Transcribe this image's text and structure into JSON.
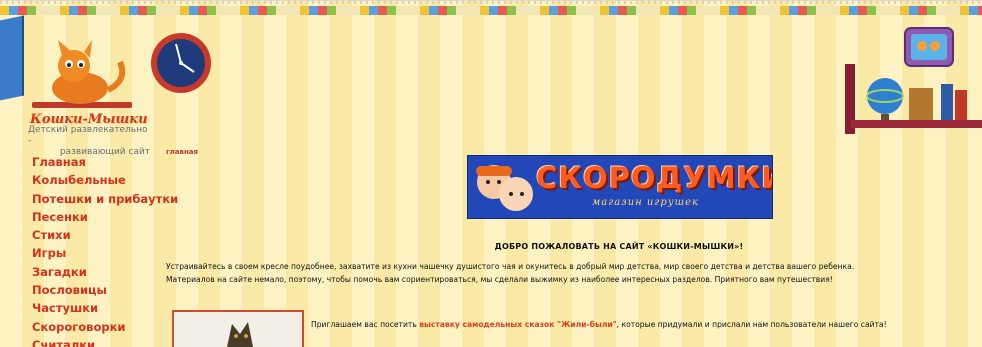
{
  "logo": {
    "title": "Кошки-Мышки",
    "subtitle_line1": "Детский развлекательно -",
    "subtitle_line2": "развивающий сайт"
  },
  "breadcrumb": "главная",
  "nav": {
    "items": [
      "Главная",
      "Колыбельные",
      "Потешки и прибаутки",
      "Песенки",
      "Стихи",
      "Игры",
      "Загадки",
      "Пословицы",
      "Частушки",
      "Скороговорки",
      "Считалки"
    ]
  },
  "banner": {
    "title": "СКОРОДУМКИ",
    "subtitle": "магазин игрушек"
  },
  "welcome": {
    "heading": "ДОБРО ПОЖАЛОВАТЬ НА САЙТ «КОШКИ-МЫШКИ»!",
    "line1": "Устраивайтесь в своем кресле поудобнее, захватите из кухни чашечку душистого чая и окунитесь в добрый мир детства, мир своего детства и детства вашего ребенка.",
    "line2": "Материалов на сайте немало, поэтому, чтобы помочь вам сориентироваться, мы сделали выжимку из наиболее интересных разделов. Приятного вам путешествия!"
  },
  "invite": {
    "prefix": "Приглашаем вас посетить ",
    "link": "выставку самодельных сказок \"Жили-были\"",
    "suffix": ", которые придумали и прислали нам пользователи нашего сайта!"
  },
  "colors": {
    "nav_link": "#d4321c",
    "banner_bg": "#2147b8",
    "banner_title": "#ff5a1f",
    "accent_link": "#d9401c",
    "page_stripe_light": "#fdf3c2",
    "page_stripe_dark": "#fbe9a8"
  },
  "icons": {
    "mascot": "cat-mascot-icon",
    "clock": "wall-clock-icon",
    "photo": "framed-photo-icon",
    "shelf": "bookshelf-globe-icon"
  }
}
